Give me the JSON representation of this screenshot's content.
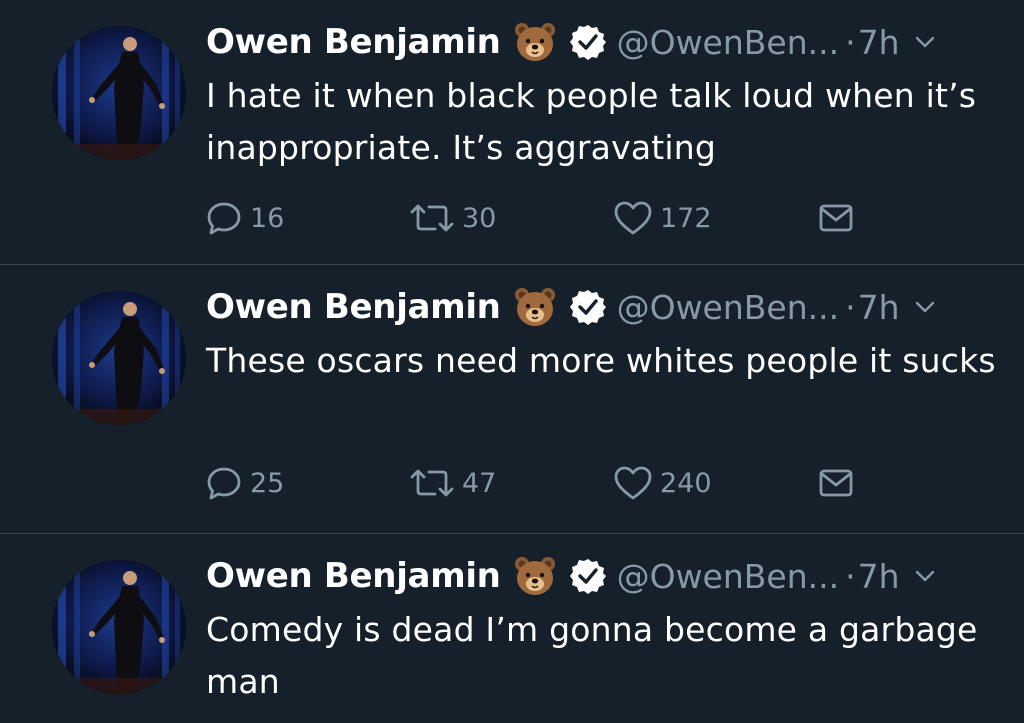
{
  "tweets": [
    {
      "author_name": "Owen Benjamin",
      "author_emoji": "bear-face-emoji",
      "handle": "@OwenBen...",
      "separator": "·",
      "time": "7h",
      "text": "I hate it when black people talk loud when it’s inappropriate. It’s aggravating",
      "replies": "16",
      "retweets": "30",
      "likes": "172"
    },
    {
      "author_name": "Owen Benjamin",
      "author_emoji": "bear-face-emoji",
      "handle": "@OwenBen...",
      "separator": "·",
      "time": "7h",
      "text": "These oscars need more whites people it sucks",
      "replies": "25",
      "retweets": "47",
      "likes": "240"
    },
    {
      "author_name": "Owen Benjamin",
      "author_emoji": "bear-face-emoji",
      "handle": "@OwenBen...",
      "separator": "·",
      "time": "7h",
      "text": "Comedy is dead I’m gonna become a garbage man"
    }
  ],
  "colors": {
    "background": "#15202b",
    "divider": "#38444d",
    "secondary_text": "#8899a6",
    "primary_text": "#ffffff"
  }
}
